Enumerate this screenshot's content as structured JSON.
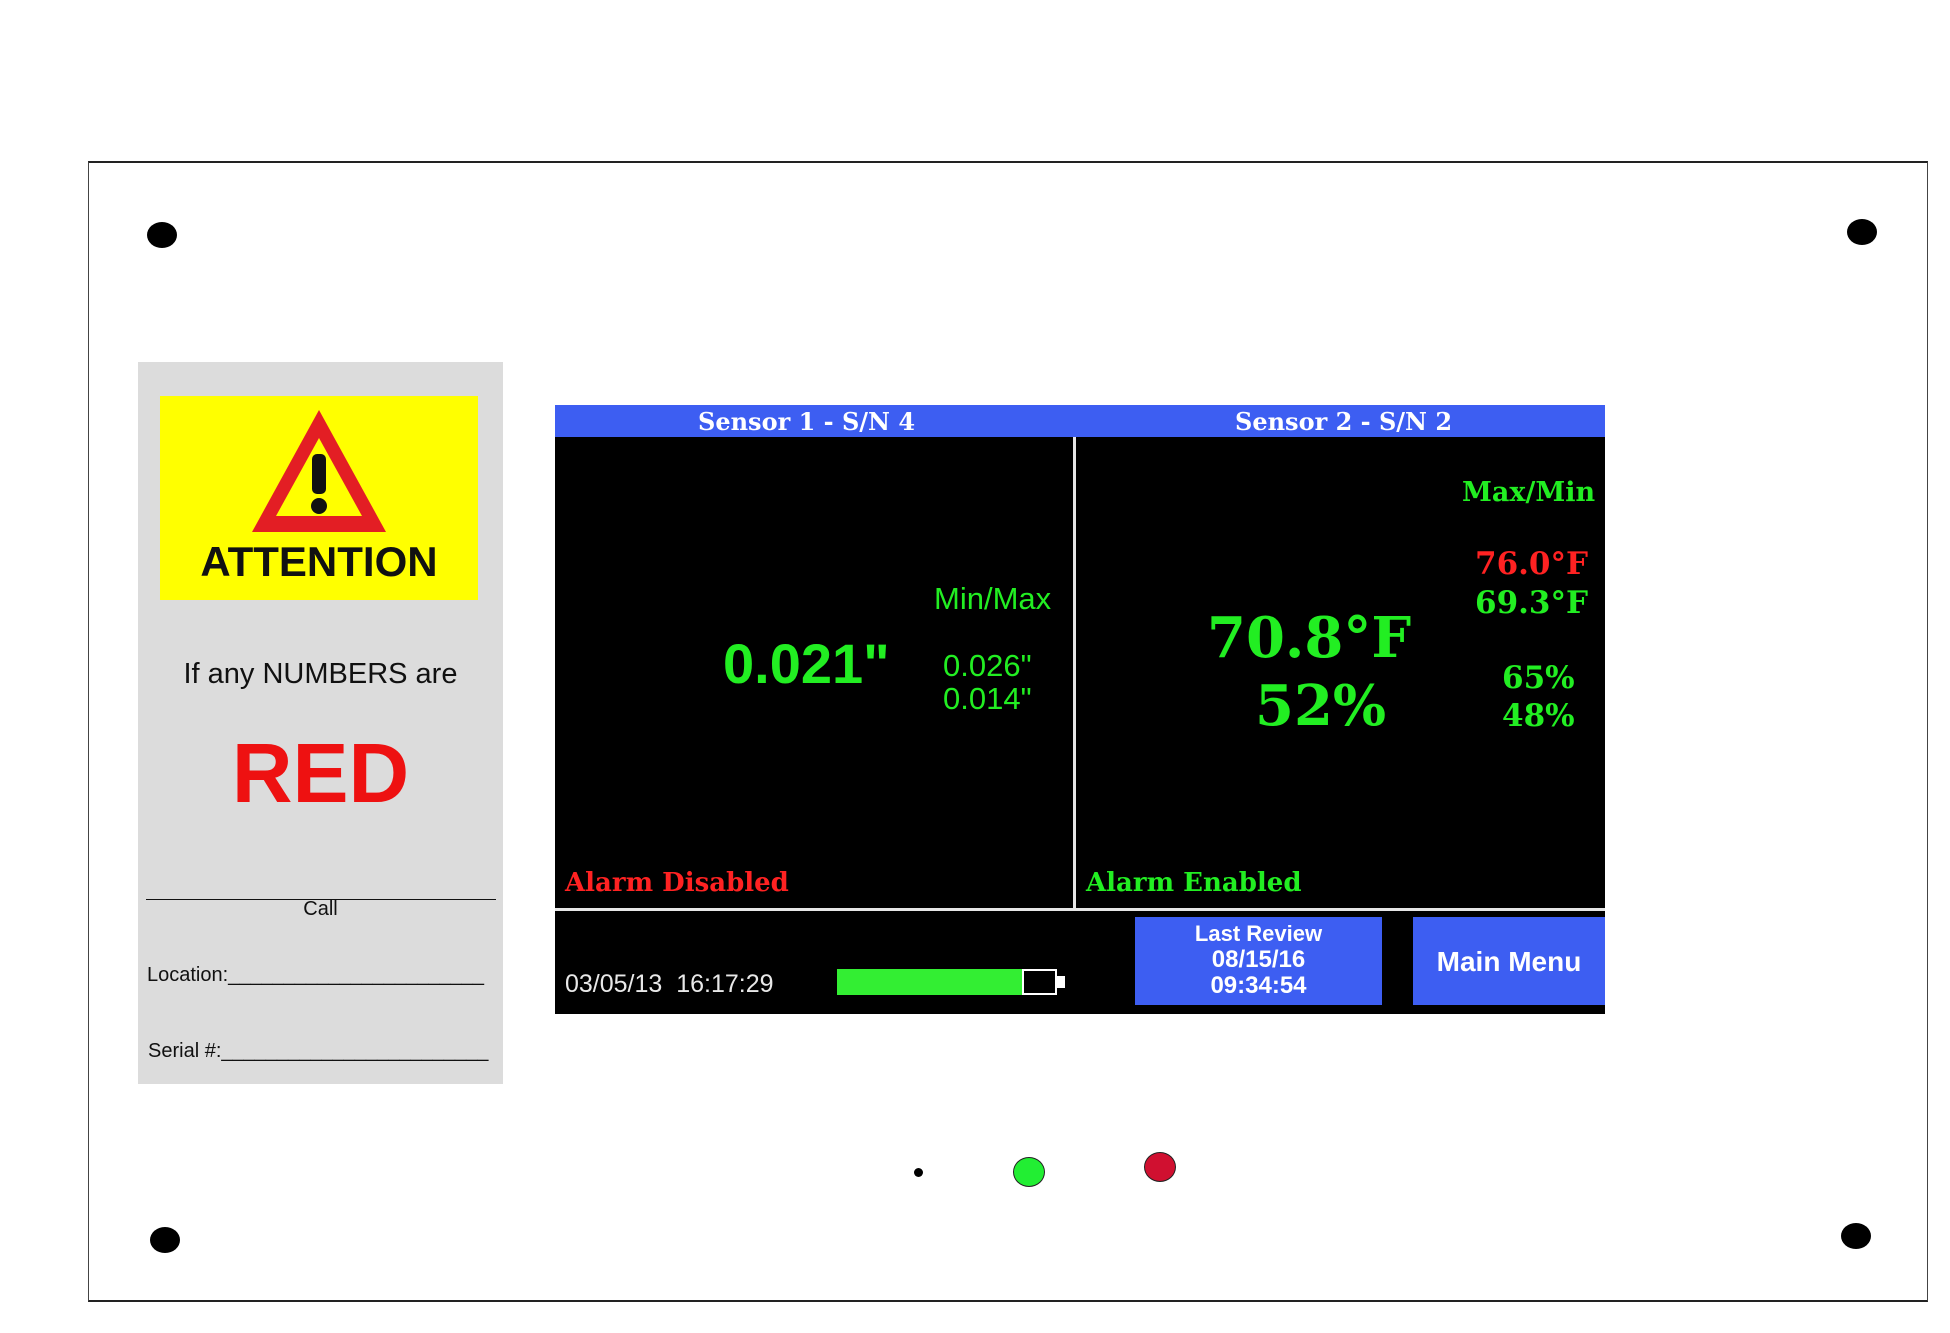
{
  "attention_card": {
    "heading": "ATTENTION",
    "line1": "If any NUMBERS are",
    "emphasis": "RED",
    "call_label": "Call",
    "location_label": "Location:_______________________",
    "serial_label": "Serial #:________________________"
  },
  "display": {
    "sensor1": {
      "header": "Sensor 1 - S/N 4",
      "minmax_label": "Min/Max",
      "reading": "0.021\"",
      "max_value": "0.026\"",
      "min_value": "0.014\"",
      "alarm_status": "Alarm Disabled"
    },
    "sensor2": {
      "header": "Sensor 2 - S/N 2",
      "maxmin_label": "Max/Min",
      "temperature": "70.8°F",
      "humidity": "52%",
      "temp_max": "76.0°F",
      "temp_min": "69.3°F",
      "hum_max": "65%",
      "hum_min": "48%",
      "alarm_status": "Alarm Enabled"
    },
    "footer": {
      "datetime": "03/05/13  16:17:29",
      "battery_level": 0.85,
      "last_review_label": "Last Review",
      "last_review_date": "08/15/16",
      "last_review_time": "09:34:54",
      "main_menu_label": "Main Menu"
    }
  },
  "colors": {
    "header_blue": "#3d5ef2",
    "reading_green": "#22ee22",
    "alarm_red": "#ff2222",
    "warning_yellow": "#ffff00",
    "card_gray": "#dcdcdc"
  },
  "icons": [
    "warning-triangle-icon",
    "battery-icon"
  ]
}
